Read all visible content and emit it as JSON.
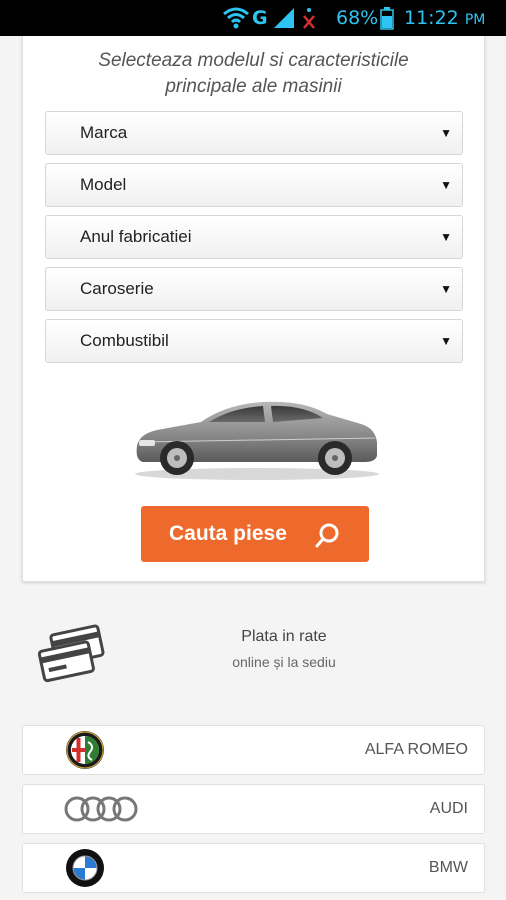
{
  "status_bar": {
    "network": "G",
    "battery": "68%",
    "time": "11:22",
    "ampm": "PM"
  },
  "intro": {
    "line1": "Selecteaza modelul si caracteristicile",
    "line2": "principale ale masinii"
  },
  "selects": {
    "marca": "Marca",
    "model": "Model",
    "an": "Anul fabricatiei",
    "caroserie": "Caroserie",
    "combustibil": "Combustibil",
    "arrow": "▼"
  },
  "search_button": {
    "label": "Cauta piese"
  },
  "payment": {
    "title": "Plata in rate",
    "subtitle": "online și la sediu"
  },
  "brands": {
    "alfa": "ALFA ROMEO",
    "audi": "AUDI",
    "bmw": "BMW"
  },
  "colors": {
    "accent": "#ee6a2c",
    "statusbar_icons": "#2ec4f1",
    "alert": "#d32f2f"
  }
}
